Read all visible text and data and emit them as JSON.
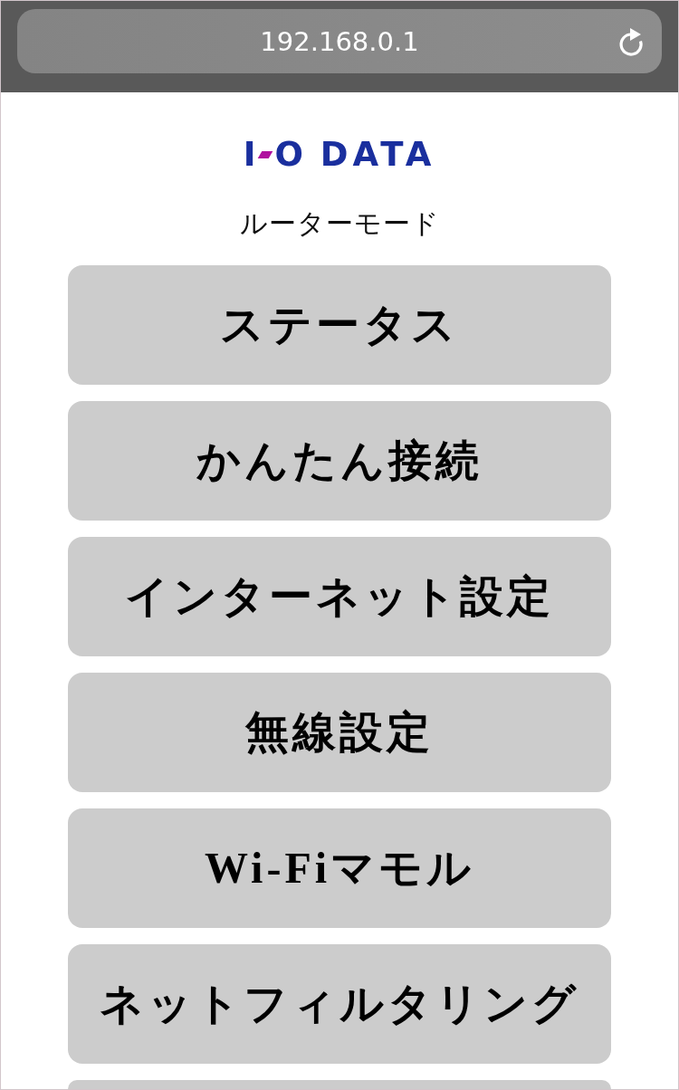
{
  "browser_bar": {
    "url": "192.168.0.1"
  },
  "logo": {
    "parts": [
      "I",
      "O DATA"
    ]
  },
  "mode_label": "ルーターモード",
  "menu": {
    "buttons": [
      "ステータス",
      "かんたん接続",
      "インターネット設定",
      "無線設定",
      "Wi-Fiマモル",
      "ネットフィルタリング"
    ],
    "more_below": true
  }
}
